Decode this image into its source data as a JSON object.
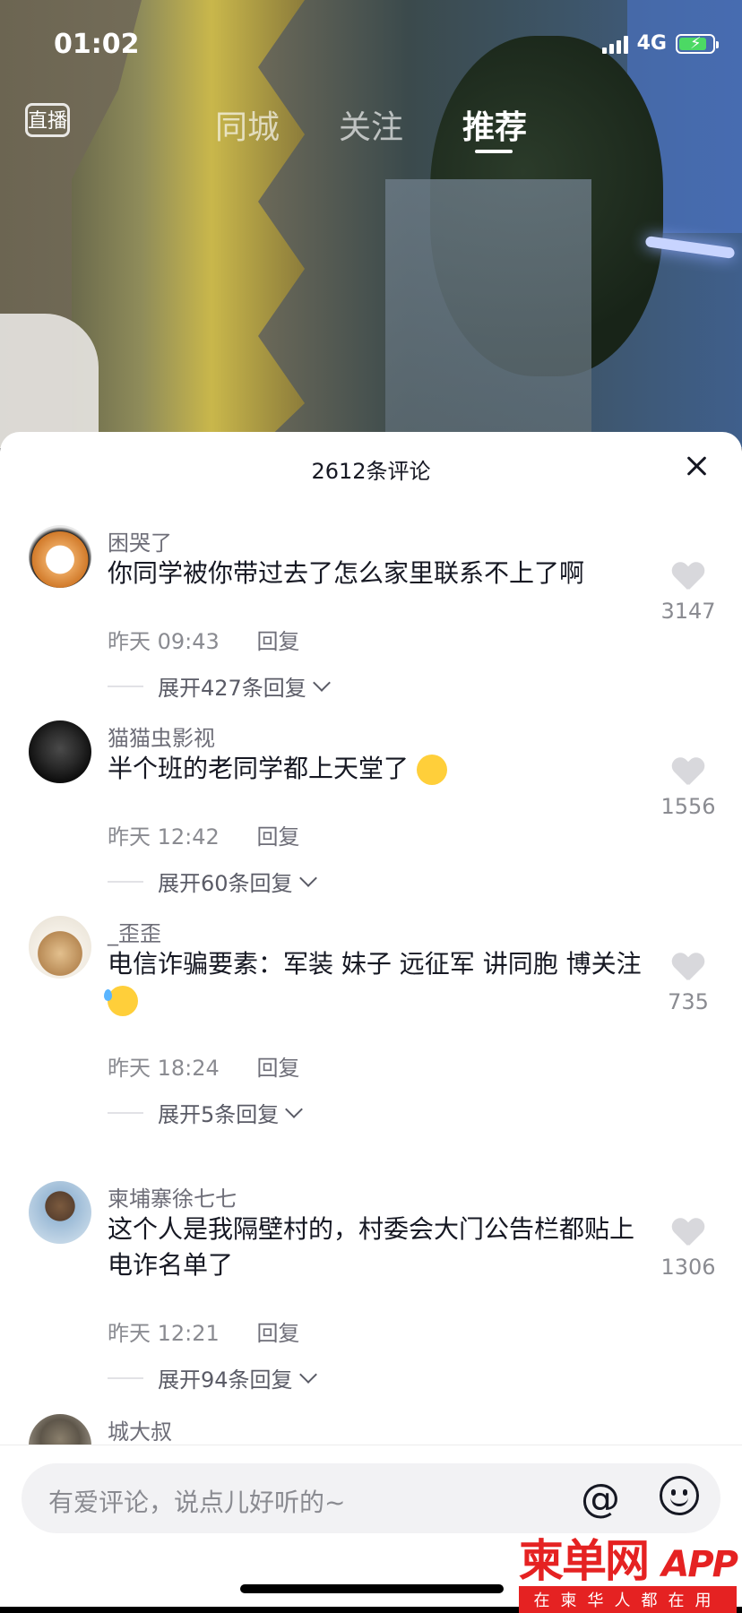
{
  "status_bar": {
    "time": "01:02",
    "network": "4G"
  },
  "top_nav": {
    "live_label": "直播",
    "tabs": [
      {
        "label": "同城",
        "active": false
      },
      {
        "label": "关注",
        "active": false
      },
      {
        "label": "推荐",
        "active": true
      }
    ]
  },
  "comments_panel": {
    "title": "2612条评论",
    "comments": [
      {
        "user": "困哭了",
        "text": "你同学被你带过去了怎么家里联系不上了啊",
        "emoji": "",
        "time": "昨天 09:43",
        "reply_label": "回复",
        "expand": "展开427条回复",
        "likes": "3147"
      },
      {
        "user": "猫猫虫影视",
        "text": "半个班的老同学都上天堂了",
        "emoji": "pleading-face",
        "time": "昨天 12:42",
        "reply_label": "回复",
        "expand": "展开60条回复",
        "likes": "1556"
      },
      {
        "user": "_歪歪",
        "text": "电信诈骗要素：军装 妹子 远征军 讲同胞 博关注",
        "emoji": "thinking-sweat",
        "time": "昨天 18:24",
        "reply_label": "回复",
        "expand": "展开5条回复",
        "likes": "735"
      },
      {
        "user": "柬埔寨徐七七",
        "text": "这个人是我隔壁村的，村委会大门公告栏都贴上电诈名单了",
        "emoji": "",
        "time": "昨天 12:21",
        "reply_label": "回复",
        "expand": "展开94条回复",
        "likes": "1306"
      },
      {
        "user": "城大叔",
        "text": "",
        "emoji": "",
        "time": "",
        "reply_label": "",
        "expand": "",
        "likes": ""
      }
    ]
  },
  "input_bar": {
    "placeholder": "有爱评论，说点儿好听的~",
    "at_symbol": "@"
  },
  "watermark": {
    "title": "柬单网",
    "app": "APP",
    "subtitle": "在柬华人都在用"
  }
}
